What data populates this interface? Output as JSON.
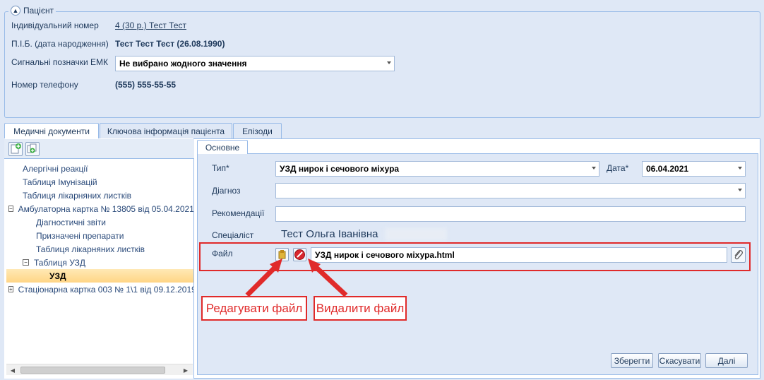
{
  "patient": {
    "group_title": "Пацієнт",
    "fields": {
      "individual_number_label": "Індивідуальний номер",
      "individual_number_value": "4 (30 р.) Тест Тест",
      "pib_label": "П.І.Б. (дата народження)",
      "pib_value": "Тест Тест Тест (26.08.1990)",
      "emk_label": "Сигнальні позначки ЕМК",
      "emk_value": "Не вибрано жодного значення",
      "phone_label": "Номер телефону",
      "phone_value": "(555) 555-55-55"
    }
  },
  "tabs": [
    {
      "label": "Медичні документи",
      "active": true
    },
    {
      "label": "Ключова інформація пацієнта",
      "active": false
    },
    {
      "label": "Епізоди",
      "active": false
    }
  ],
  "tree": [
    {
      "label": "Алергічні реакції",
      "level": 1
    },
    {
      "label": "Таблиця Імунізацій",
      "level": 1
    },
    {
      "label": "Таблиця лікарняних листків",
      "level": 1
    },
    {
      "label": "Амбулаторна картка № 13805 від 05.04.2021",
      "level": 0,
      "expander": "⊟"
    },
    {
      "label": "Діагностичні звіти",
      "level": 2
    },
    {
      "label": "Призначені препарати",
      "level": 2
    },
    {
      "label": "Таблиця лікарняних листків",
      "level": 2
    },
    {
      "label": "Таблиця УЗД",
      "level": 1,
      "expander": "⊟"
    },
    {
      "label": "УЗД",
      "level": 3,
      "selected": true
    },
    {
      "label": "Стаціонарна картка 003 № 1\\1 від 09.12.2019",
      "level": 0,
      "expander": "⊞"
    }
  ],
  "form": {
    "tab_label": "Основне",
    "type_label": "Тип*",
    "type_value": "УЗД нирок і сечового міхура",
    "date_label": "Дата*",
    "date_value": "06.04.2021",
    "diagnosis_label": "Діагноз",
    "diagnosis_value": "",
    "recommendations_label": "Рекомендації",
    "recommendations_value": "",
    "specialist_label": "Спеціаліст",
    "specialist_value": "Тест Ольга Іванівна",
    "file_label": "Файл",
    "file_value": "УЗД нирок і сечового міхура.html"
  },
  "buttons": {
    "save": "Зберегти",
    "cancel": "Скасувати",
    "next": "Далі"
  },
  "annotations": {
    "edit_file": "Редагувати файл",
    "delete_file": "Видалити файл"
  },
  "colors": {
    "accent_red": "#e02a2a",
    "border_blue": "#99bbe8",
    "background": "#dfe8f6"
  }
}
